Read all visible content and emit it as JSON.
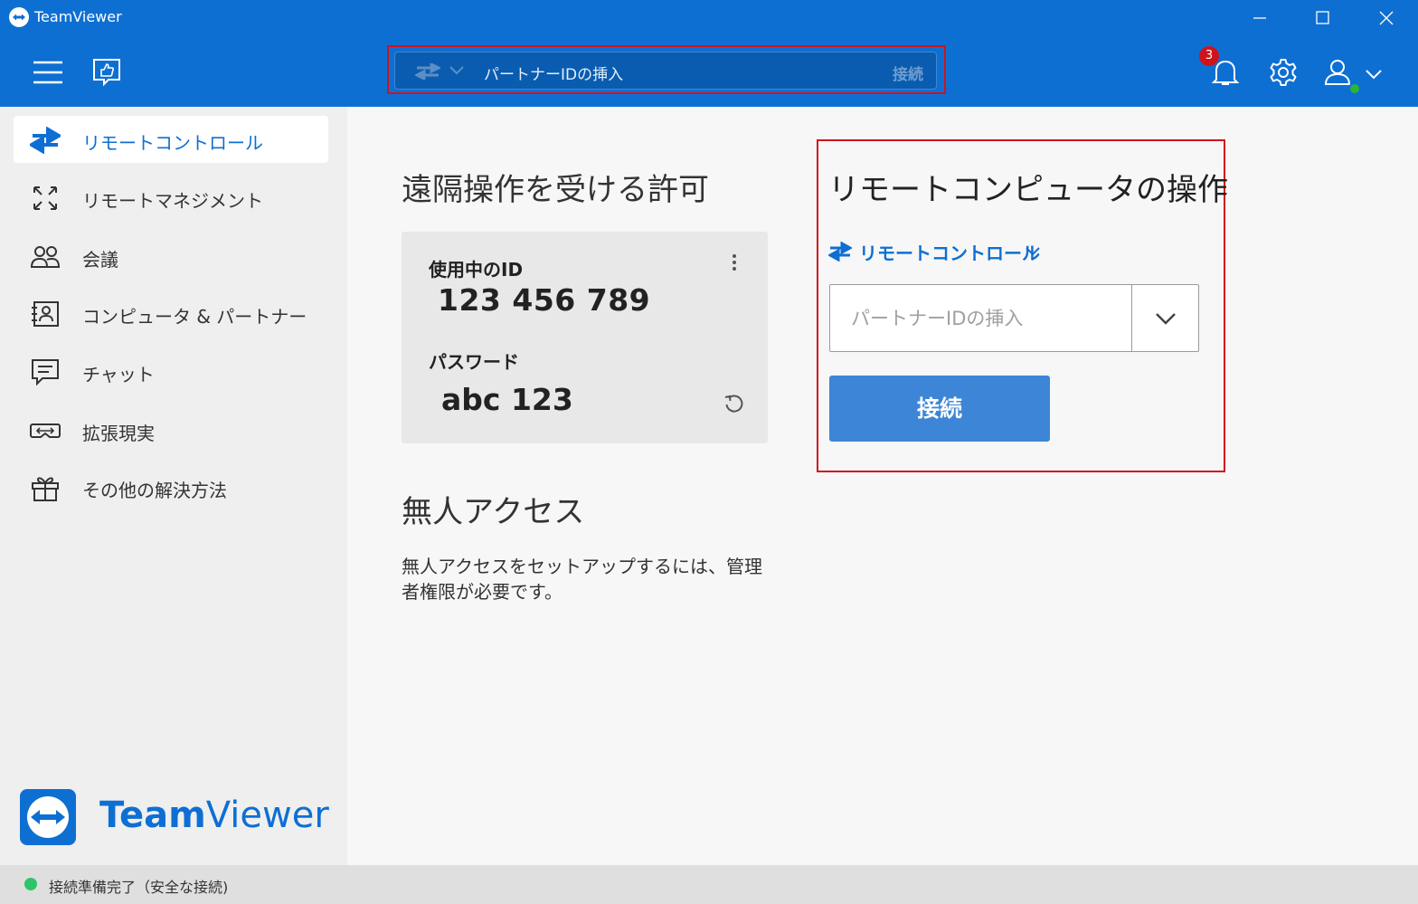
{
  "window": {
    "title": "TeamViewer",
    "icons": [
      "minimize-icon",
      "maximize-icon",
      "close-icon"
    ]
  },
  "toolbar": {
    "menu_icon": "hamburger-menu-icon",
    "feedback_icon": "thumbs-up-feedback-icon",
    "quick_connect": {
      "placeholder": "パートナーIDの挿入",
      "connect_label": "接続",
      "mode_icon": "swap-arrows-icon"
    },
    "notifications": {
      "count": "3",
      "icon": "bell-icon"
    },
    "settings_icon": "gear-icon",
    "account": {
      "icon": "user-icon",
      "online_color": "#2ab43a"
    }
  },
  "sidebar": {
    "items": [
      {
        "label": "リモートコントロール",
        "icon": "swap-arrows-icon",
        "active": true
      },
      {
        "label": "リモートマネジメント",
        "icon": "expand-arrows-icon"
      },
      {
        "label": "会議",
        "icon": "people-icon"
      },
      {
        "label": "コンピュータ & パートナー",
        "icon": "contact-card-icon"
      },
      {
        "label": "チャット",
        "icon": "chat-icon"
      },
      {
        "label": "拡張現実",
        "icon": "ar-goggles-icon"
      },
      {
        "label": "その他の解決方法",
        "icon": "gift-icon"
      }
    ],
    "brand": {
      "name_bold": "Team",
      "name_light": "Viewer"
    }
  },
  "allow_access": {
    "title": "遠隔操作を受ける許可",
    "id_label": "使用中のID",
    "id_value": "123 456 789",
    "password_label": "パスワード",
    "password_value": "abc 123"
  },
  "unattended": {
    "title": "無人アクセス",
    "text": "無人アクセスをセットアップするには、管理者権限が必要です。"
  },
  "remote_control": {
    "title": "リモートコンピュータの操作",
    "mode_label": "リモートコントロール",
    "partner_placeholder": "パートナーIDの挿入",
    "connect_label": "接続"
  },
  "status": {
    "text": "接続準備完了（安全な接続)",
    "color": "#2fc46a"
  },
  "colors": {
    "brand": "#0e6fd3",
    "highlight_border": "#d0131b",
    "connect_button": "#3d85d6"
  }
}
